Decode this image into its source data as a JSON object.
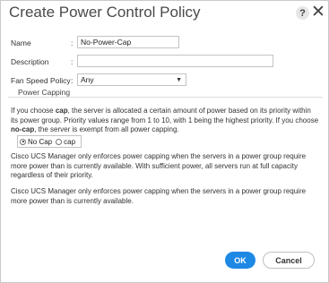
{
  "dialog": {
    "title": "Create Power Control Policy",
    "help_label": "?",
    "close_label": "✕"
  },
  "form": {
    "name_label": "Name",
    "name_value": "No-Power-Cap",
    "description_label": "Description",
    "description_value": "",
    "fan_label": "Fan Speed Policy",
    "fan_value": "Any",
    "colon": ":"
  },
  "power_capping": {
    "heading": "Power Capping",
    "para_part1": "If you choose ",
    "para_cap": "cap",
    "para_part2": ", the server is allocated a certain amount of power based on its priority within its power group. Priority values range from 1 to 10, with 1 being the highest priority. If you choose ",
    "para_nocap": "no-cap",
    "para_part3": ", the server is exempt from all power capping.",
    "options": [
      {
        "label": "No Cap",
        "selected": true
      },
      {
        "label": "cap",
        "selected": false
      }
    ],
    "note1": "Cisco UCS Manager only enforces power capping when the servers in a power group require more power than is currently available. With sufficient power, all servers run at full capacity regardless of their priority.",
    "note2": "Cisco UCS Manager only enforces power capping when the servers in a power group require more power than is currently available."
  },
  "buttons": {
    "ok": "OK",
    "cancel": "Cancel"
  },
  "colors": {
    "primary_button": "#1e88e5"
  }
}
